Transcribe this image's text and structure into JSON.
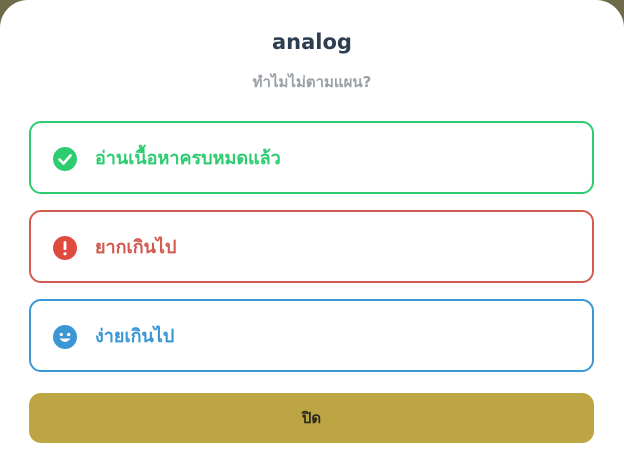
{
  "dialog": {
    "title": "analog",
    "subtitle": "ทำไมไม่ตามแผน?",
    "options": [
      {
        "label": "อ่านเนื้อหาครบหมดแล้ว",
        "icon": "check-circle-icon",
        "color": "#2ecc71"
      },
      {
        "label": "ยากเกินไป",
        "icon": "exclamation-circle-icon",
        "color": "#d35a4e"
      },
      {
        "label": "ง่ายเกินไป",
        "icon": "smile-face-icon",
        "color": "#3a97d4"
      }
    ],
    "close_label": "ปิด",
    "close_color": "#bca542"
  }
}
